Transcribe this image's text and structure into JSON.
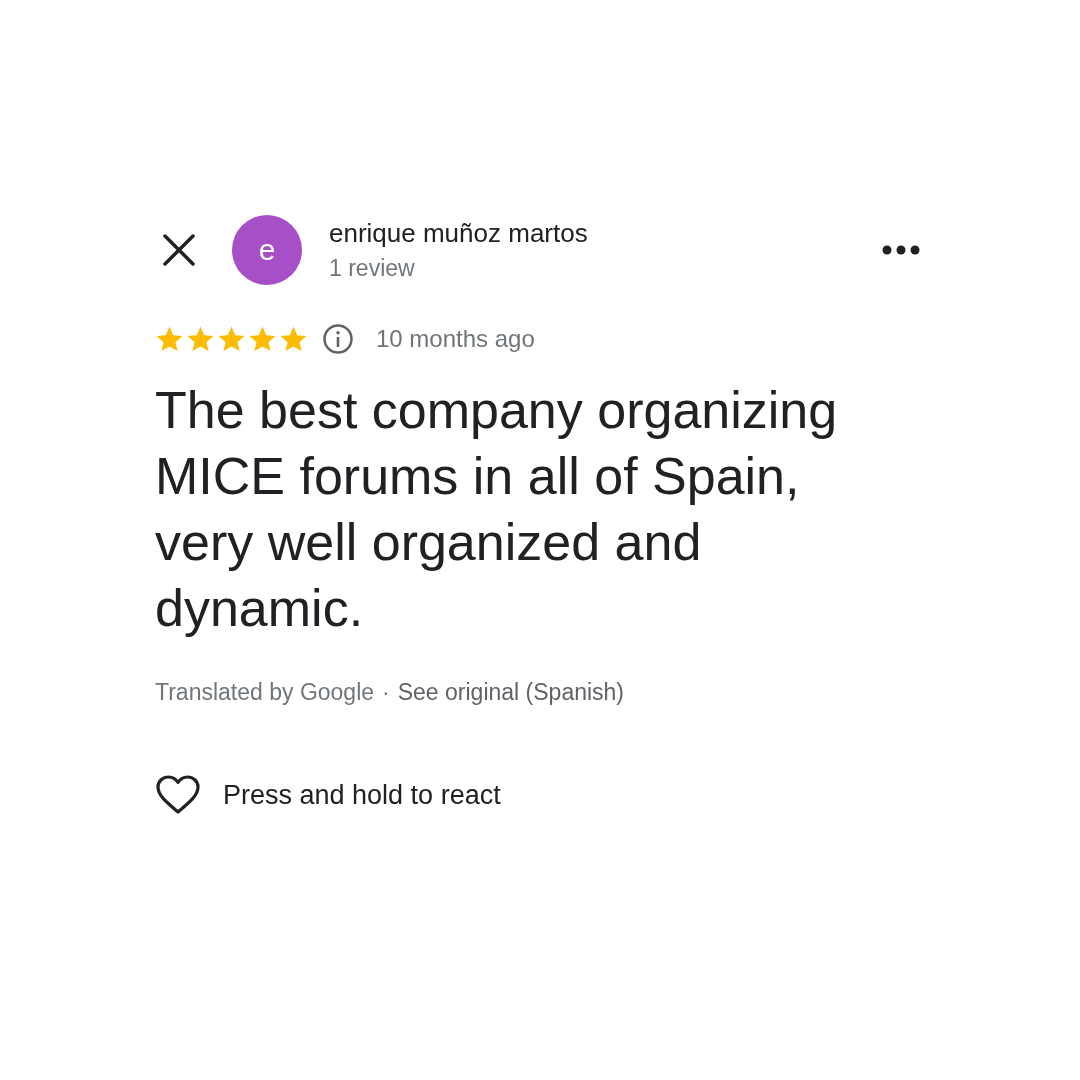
{
  "reviewer": {
    "avatar_letter": "e",
    "name": "enrique muñoz martos",
    "review_count": "1 review"
  },
  "review": {
    "stars": 5,
    "time": "10 months ago",
    "text": "The best company organizing MICE forums in all of Spain, very well organized and dynamic."
  },
  "translation": {
    "credit": "Translated by Google",
    "separator": "·",
    "link": "See original (Spanish)"
  },
  "reaction": {
    "label": "Press and hold to react"
  }
}
